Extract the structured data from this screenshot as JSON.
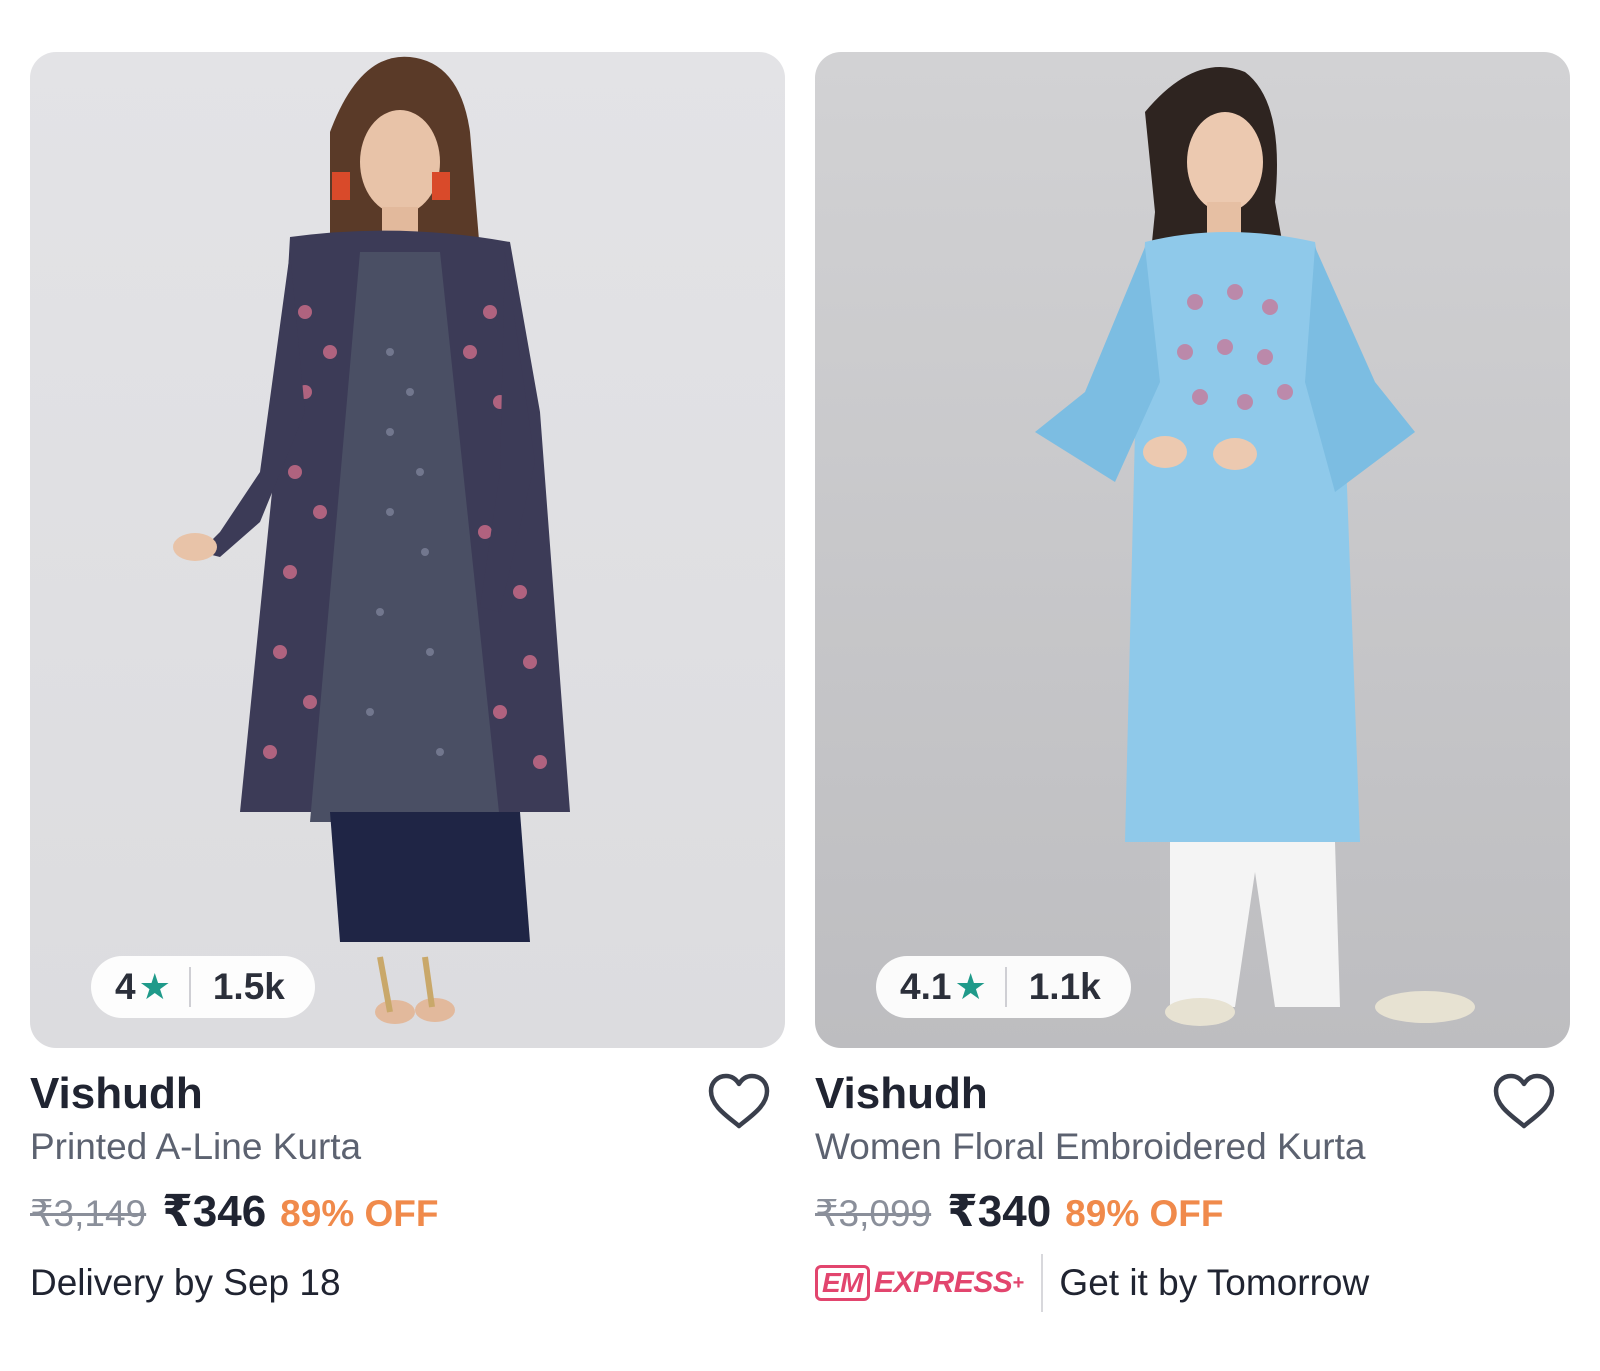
{
  "products": [
    {
      "brand": "Vishudh",
      "title": "Printed A-Line Kurta",
      "rating": "4",
      "rating_count": "1.5k",
      "mrp": "₹3,149",
      "price": "₹346",
      "discount": "89% OFF",
      "delivery": "Delivery by Sep 18",
      "image_desc": "model-printed-a-line-kurta-navy",
      "colors": {
        "kurta": "#3c3b57",
        "inner": "#4a4f64",
        "pants": "#1f2545",
        "pattern": "#c46a86"
      }
    },
    {
      "brand": "Vishudh",
      "title": "Women Floral Embroidered Kurta",
      "rating": "4.1",
      "rating_count": "1.1k",
      "mrp": "₹3,099",
      "price": "₹340",
      "discount": "89% OFF",
      "express_label": "EXPRESS",
      "express_sup": "+",
      "express_logo": "EM",
      "delivery": "Get it by Tomorrow",
      "image_desc": "model-floral-embroidered-kurta-sky-blue",
      "colors": {
        "kurta": "#8fc9ea",
        "pants": "#f4f4f4"
      }
    }
  ],
  "icons": {
    "star": "★",
    "wishlist": "heart-outline-icon"
  },
  "theme": {
    "star_color": "#1f9a8a",
    "discount_color": "#f08a4b",
    "express_color": "#e2456e",
    "text_dark": "#202431",
    "text_muted": "#5c6270"
  }
}
